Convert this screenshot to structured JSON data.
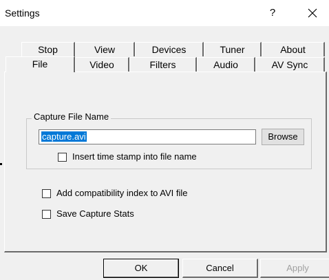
{
  "window": {
    "title": "Settings",
    "help_glyph": "?",
    "close_glyph": "✕"
  },
  "tabs": {
    "row_back": [
      "Stop",
      "View",
      "Devices",
      "Tuner",
      "About"
    ],
    "row_front": [
      "File",
      "Video",
      "Filters",
      "Audio",
      "AV Sync"
    ],
    "active": "File"
  },
  "capture": {
    "group_label": "Capture File Name",
    "filename_value": "capture.avi",
    "browse_label": "Browse",
    "timestamp_label": "Insert time stamp into file name",
    "timestamp_checked": false
  },
  "options": {
    "compat_label": "Add compatibility index to AVI file",
    "compat_checked": false,
    "stats_label": "Save Capture Stats",
    "stats_checked": false
  },
  "footer": {
    "ok_label": "OK",
    "cancel_label": "Cancel",
    "apply_label": "Apply"
  }
}
